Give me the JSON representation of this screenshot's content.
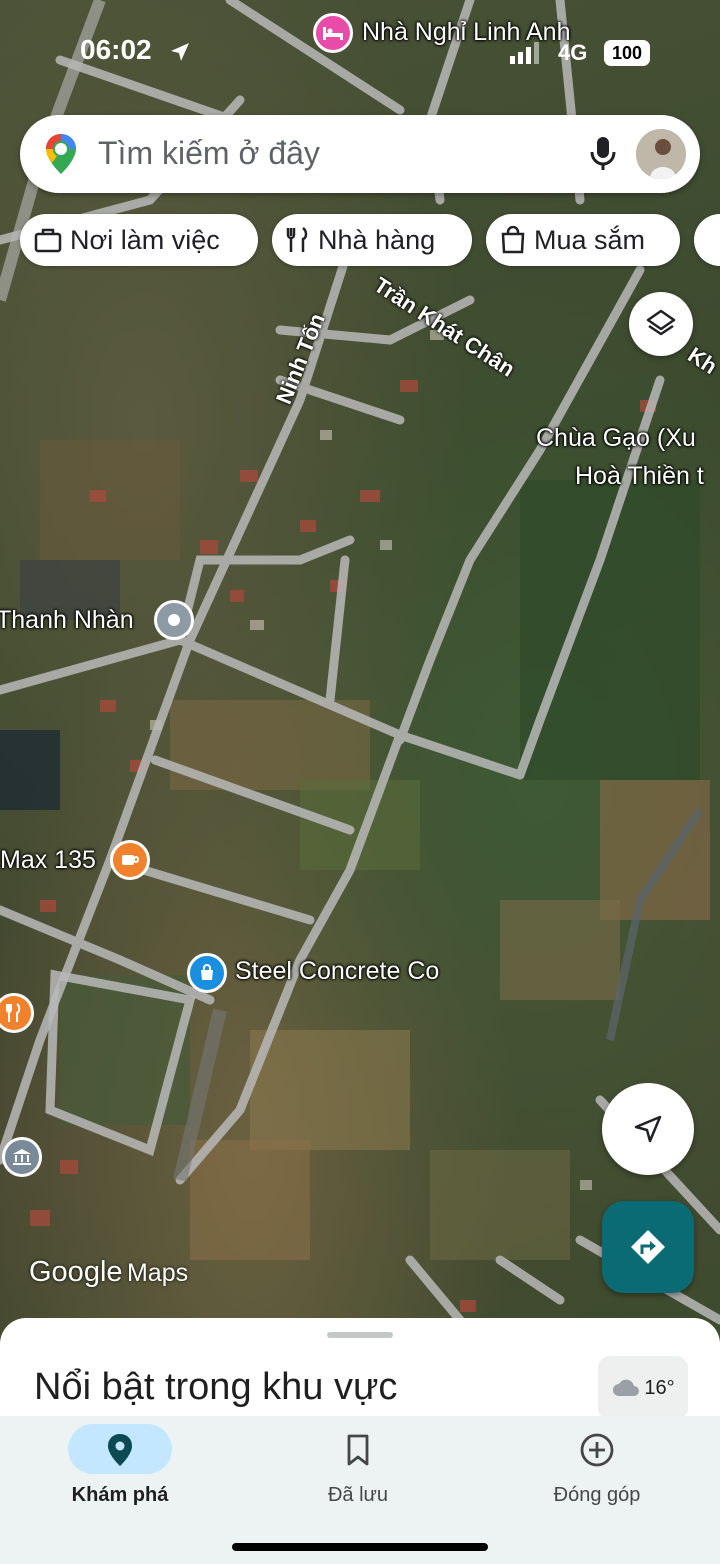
{
  "status_bar": {
    "time": "06:02",
    "signal_label": "4G",
    "battery": "100"
  },
  "search": {
    "placeholder": "Tìm kiếm ở đây"
  },
  "chips": [
    {
      "label": "Nơi làm việc",
      "icon": "briefcase-icon"
    },
    {
      "label": "Nhà hàng",
      "icon": "restaurant-icon"
    },
    {
      "label": "Mua sắm",
      "icon": "shopping-bag-icon"
    }
  ],
  "map": {
    "labels": {
      "hotel": "Nhà Nghỉ Linh Anh",
      "temple_line1": "Chùa Gạo (Xu",
      "temple_line2": "Hoà Thiền t",
      "thanh_nhan": "Thanh Nhàn",
      "max135": "Max 135",
      "steel": "Steel Concrete Co"
    },
    "roads": {
      "ninh_ton": "Ninh Tốn",
      "tran_khat_chan": "Trần Khát Chân",
      "edge_road": "Kh"
    },
    "watermark": {
      "google": "Google",
      "maps": "Maps"
    }
  },
  "sheet": {
    "title": "Nổi bật trong khu vực",
    "weather": "16°"
  },
  "nav": [
    {
      "label": "Khám phá",
      "icon": "explore-pin-icon",
      "active": true
    },
    {
      "label": "Đã lưu",
      "icon": "bookmark-icon",
      "active": false
    },
    {
      "label": "Đóng góp",
      "icon": "add-circle-icon",
      "active": false
    }
  ],
  "colors": {
    "accent": "#0b6b74",
    "nav_active_pill": "#c2e7ff",
    "hotel_pin": "#e94ba8",
    "food_pin": "#f0822e",
    "shop_pin": "#1a8fe0"
  }
}
